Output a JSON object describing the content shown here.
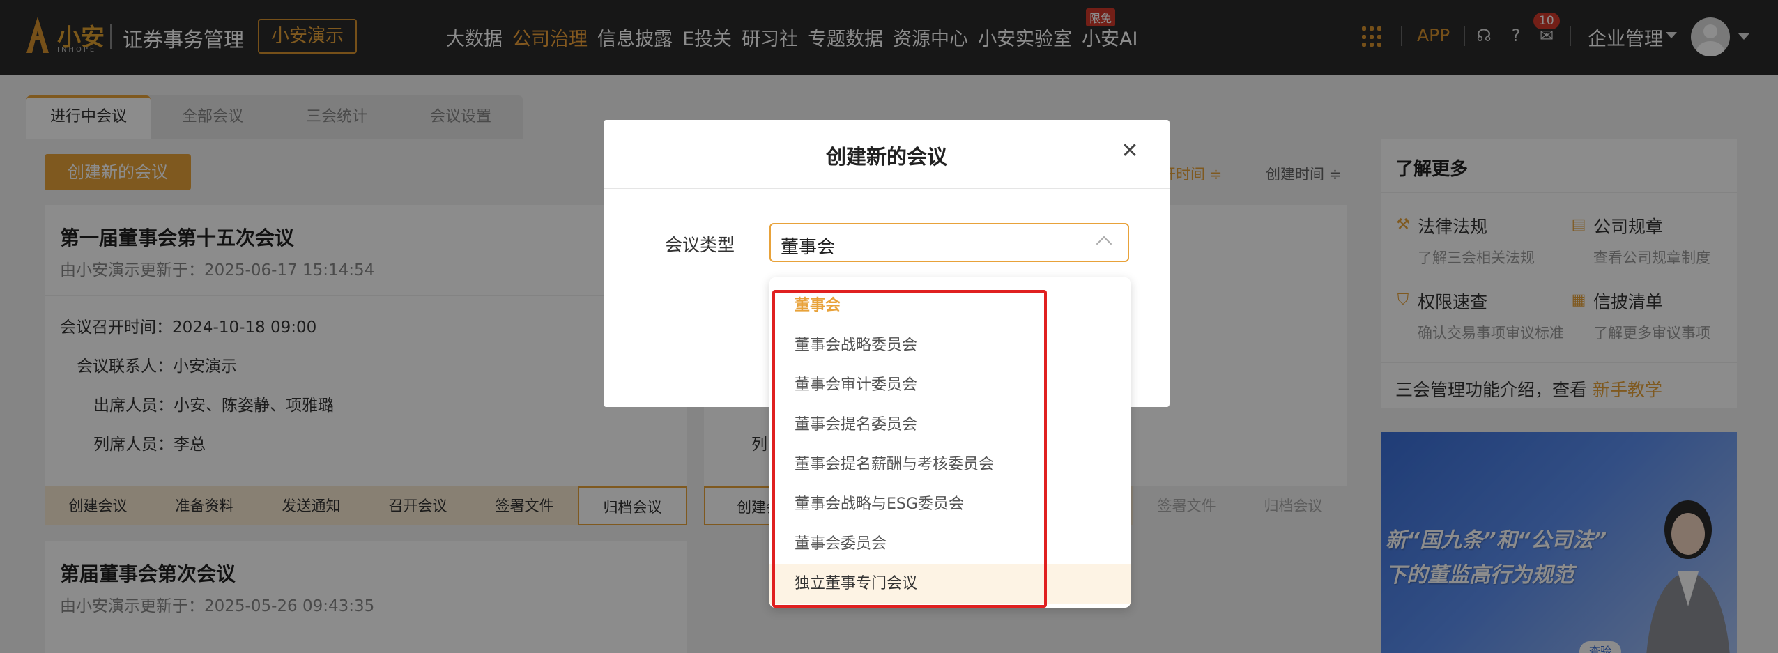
{
  "app": {
    "brand": "小安",
    "brand_sub": "INHOPE",
    "title": "证券事务管理",
    "demo_button": "小安演示"
  },
  "nav": {
    "items": [
      "大数据",
      "公司治理",
      "信息披露",
      "E投关",
      "研习社",
      "专题数据",
      "资源中心",
      "小安实验室",
      "小安AI"
    ],
    "active_index": 1,
    "free_badge": "限免",
    "app_link": "APP",
    "notification_count": "10",
    "enterprise": "企业管理"
  },
  "tabs": [
    "进行中会议",
    "全部会议",
    "三会统计",
    "会议设置"
  ],
  "create_button": "创建新的会议",
  "sort": {
    "partial": "开时间 ≑",
    "created": "创建时间 ≑"
  },
  "meetings": [
    {
      "title": "第一届董事会第十五次会议",
      "updated": "由小安演示更新于：2025-06-17 15:14:54",
      "time_label": "会议召开时间：",
      "time": "2024-10-18 09:00",
      "contact_label": "会议联系人：",
      "contact": "小安演示",
      "attendees_label": "出席人员：",
      "attendees": "小安、陈姿静、项雅璐",
      "observers_label": "列席人员：",
      "observers": "李总",
      "steps": [
        "创建会议",
        "准备资料",
        "发送通知",
        "召开会议",
        "签署文件",
        "归档会议"
      ]
    },
    {
      "title": "第届董事会第次会议",
      "updated": "由小安演示更新于：2025-05-26 09:43:35"
    }
  ],
  "second_column": {
    "step_first": "创建会",
    "step_sign": "签署文件",
    "step_archive": "归档会议",
    "partial_label": "列"
  },
  "right_panel": {
    "title": "了解更多",
    "items": [
      {
        "title": "法律法规",
        "sub": "了解三会相关法规",
        "icon": "hammer-icon"
      },
      {
        "title": "公司规章",
        "sub": "查看公司规章制度",
        "icon": "document-icon"
      },
      {
        "title": "权限速查",
        "sub": "确认交易事项审议标准",
        "icon": "shield-icon"
      },
      {
        "title": "信披清单",
        "sub": "了解更多审议事项",
        "icon": "clipboard-icon"
      }
    ],
    "footer_text": "三会管理功能介绍，查看",
    "footer_link": "新手教学"
  },
  "banner": {
    "line1": "新“国九条”和“公司法”",
    "line2": "下的董监高行为规范",
    "button": "查验"
  },
  "modal": {
    "title": "创建新的会议",
    "field_label": "会议类型",
    "selected_value": "董事会",
    "options": [
      "董事会",
      "董事会战略委员会",
      "董事会审计委员会",
      "董事会提名委员会",
      "董事会提名薪酬与考核委员会",
      "董事会战略与ESG委员会",
      "董事会委员会",
      "独立董事专门会议"
    ],
    "selected_index": 0,
    "hover_index": 7
  },
  "colors": {
    "accent": "#e8a23a",
    "topbar": "#2b2b2b",
    "highlight": "#e02020"
  }
}
